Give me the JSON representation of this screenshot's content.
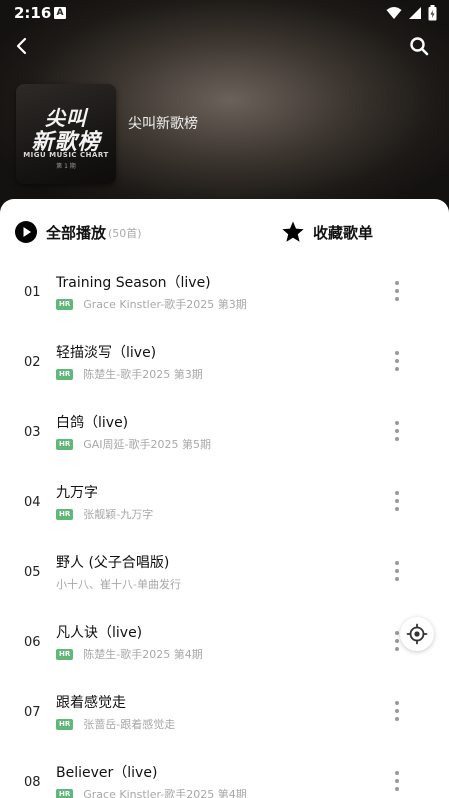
{
  "status_bar": {
    "time": "2:16",
    "notification_letter": "A",
    "icons": [
      "wifi-icon",
      "signal-icon",
      "battery-icon"
    ]
  },
  "header": {
    "back_icon": "chevron-left-icon",
    "search_icon": "search-icon",
    "cover": {
      "line1": "尖叫",
      "line2": "新歌榜",
      "line3": "MIGU MUSIC CHART",
      "line4": "第 1 期"
    },
    "playlist_title": "尖叫新歌榜"
  },
  "actions": {
    "play_all_label": "全部播放",
    "play_all_count": "(50首)",
    "favorite_label": "收藏歌单"
  },
  "songs": [
    {
      "num": "01",
      "title": "Training Season（live)",
      "hr": true,
      "badge": "HR",
      "artist": "Grace Kinstler-歌手2025 第3期"
    },
    {
      "num": "02",
      "title": "轻描淡写（live)",
      "hr": true,
      "badge": "HR",
      "artist": "陈楚生-歌手2025 第3期"
    },
    {
      "num": "03",
      "title": "白鸽（live)",
      "hr": true,
      "badge": "HR",
      "artist": "GAI周延-歌手2025 第5期"
    },
    {
      "num": "04",
      "title": "九万字",
      "hr": true,
      "badge": "HR",
      "artist": "张靓颖-九万字"
    },
    {
      "num": "05",
      "title": "野人 (父子合唱版)",
      "hr": false,
      "badge": "",
      "artist": "小十八、崔十八-单曲发行"
    },
    {
      "num": "06",
      "title": "凡人诀（live)",
      "hr": true,
      "badge": "HR",
      "artist": "陈楚生-歌手2025 第4期"
    },
    {
      "num": "07",
      "title": "跟着感觉走",
      "hr": true,
      "badge": "HR",
      "artist": "张蔷岳-跟着感觉走"
    },
    {
      "num": "08",
      "title": "Believer（live)",
      "hr": true,
      "badge": "HR",
      "artist": "Grace Kinstler-歌手2025 第4期"
    }
  ],
  "floating": {
    "locate_icon": "locate-icon"
  },
  "colors": {
    "hr_badge": "#5fb878",
    "accent_text": "#111111",
    "secondary_text": "#a8a8a8"
  }
}
